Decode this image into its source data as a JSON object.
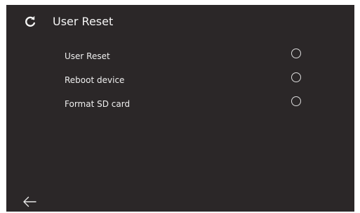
{
  "header": {
    "icon": "reset-icon",
    "title": "User Reset"
  },
  "options": [
    {
      "label": "User Reset",
      "selected": false
    },
    {
      "label": "Reboot device",
      "selected": false
    },
    {
      "label": "Format SD card",
      "selected": false
    }
  ],
  "footer": {
    "back_icon": "arrow-left-icon"
  },
  "colors": {
    "background": "#2b2728",
    "text": "#f2f2f2",
    "radio_border": "#dcdcdc"
  }
}
